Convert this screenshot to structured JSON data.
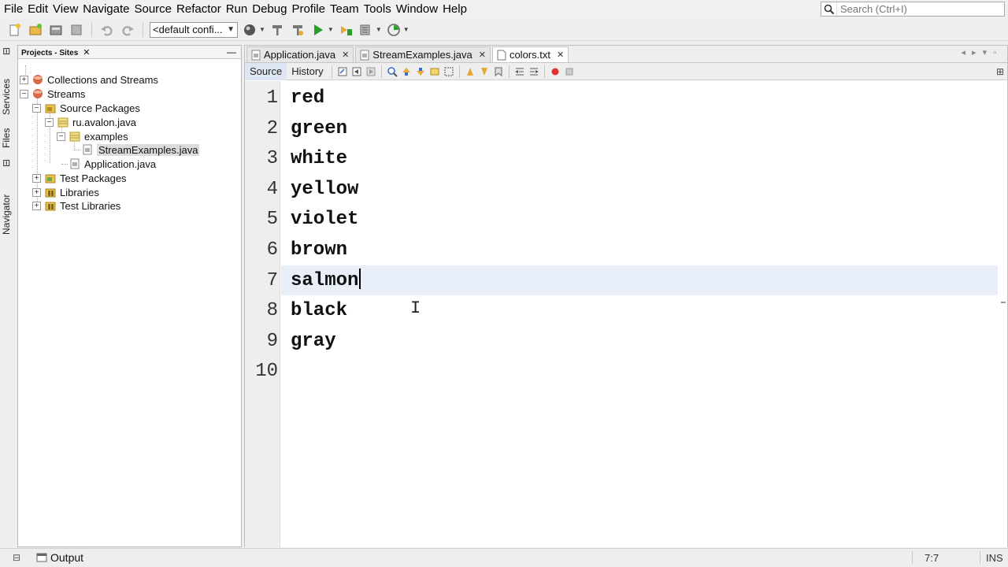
{
  "menu": [
    "File",
    "Edit",
    "View",
    "Navigate",
    "Source",
    "Refactor",
    "Run",
    "Debug",
    "Profile",
    "Team",
    "Tools",
    "Window",
    "Help"
  ],
  "search": {
    "placeholder": "Search (Ctrl+I)"
  },
  "toolbar": {
    "config_value": "<default confi..."
  },
  "side_tabs": {
    "services": "Services",
    "files": "Files",
    "navigator": "Navigator"
  },
  "projects": {
    "tab_label": "Projects - Sites",
    "tree": [
      {
        "label": "Collections and Streams",
        "expander": "+"
      },
      {
        "label": "Streams",
        "expander": "−"
      },
      {
        "label": "Source Packages",
        "expander": "−"
      },
      {
        "label": "ru.avalon.java",
        "expander": "−"
      },
      {
        "label": "examples",
        "expander": "−"
      },
      {
        "label": "StreamExamples.java",
        "expander": ""
      },
      {
        "label": "Application.java",
        "expander": ""
      },
      {
        "label": "Test Packages",
        "expander": "+"
      },
      {
        "label": "Libraries",
        "expander": "+"
      },
      {
        "label": "Test Libraries",
        "expander": "+"
      }
    ]
  },
  "editor": {
    "tabs": [
      {
        "label": "Application.java",
        "active": false
      },
      {
        "label": "StreamExamples.java",
        "active": false
      },
      {
        "label": "colors.txt",
        "active": true
      }
    ],
    "view_tabs": {
      "source": "Source",
      "history": "History"
    },
    "lines": [
      "red",
      "green",
      "white",
      "yellow",
      "violet",
      "brown",
      "salmon",
      "black",
      "gray",
      ""
    ],
    "line_numbers": [
      "1",
      "2",
      "3",
      "4",
      "5",
      "6",
      "7",
      "8",
      "9",
      "10"
    ],
    "current_line": 7
  },
  "status": {
    "output_label": "Output",
    "position": "7:7",
    "mode": "INS"
  },
  "colors": {
    "current_line_bg": "#e9eff8",
    "selection_bg": "#dcdcdc",
    "breakpoint_red": "#e03030",
    "run_green": "#2aa02a"
  }
}
